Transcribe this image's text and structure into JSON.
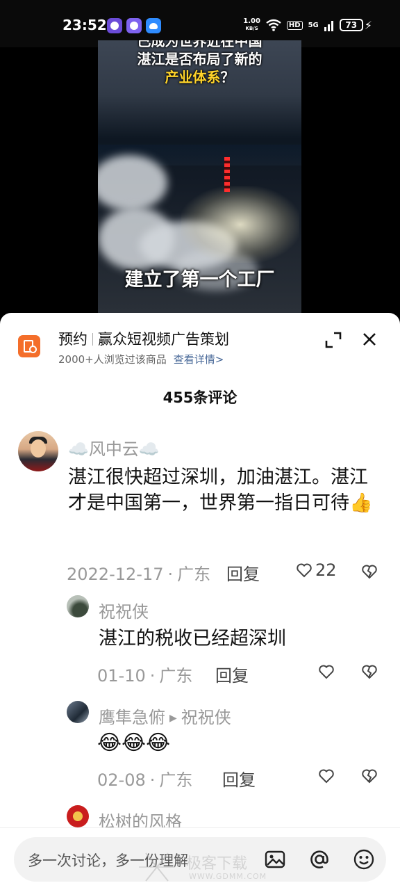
{
  "status_bar": {
    "time": "23:52",
    "net_speed": "1.00",
    "net_speed_unit": "KB/S",
    "hd_badge": "HD",
    "network": "5G",
    "battery": "73",
    "icons": [
      "app-notification-icon",
      "app-notification-icon",
      "cloud-app-icon",
      "wifi-icon",
      "signal-icon",
      "battery-icon",
      "charging-icon"
    ]
  },
  "video": {
    "caption_top": {
      "line1": "已成为世界近在中国",
      "line2": "湛江是否布局了新的",
      "line3_highlight": "产业体系",
      "line3_tail": "？"
    },
    "caption_bottom": "建立了第一个工厂"
  },
  "promo": {
    "tag": "预约",
    "title": "赢众短视频广告策划",
    "views": "2000+人浏览过该商品",
    "link": "查看详情>",
    "accent_color": "#f46e2a"
  },
  "comments_header": "455条评论",
  "comments": [
    {
      "username": "☁️风中云☁️",
      "text": "湛江很快超过深圳，加油湛江。湛江才是中国第一，世界第一指日可待👍",
      "date": "2022-12-17",
      "location": "广东",
      "reply_label": "回复",
      "likes": "22"
    },
    {
      "username": "祝祝侠",
      "text": "湛江的税收已经超深圳",
      "date": "01-10",
      "location": "广东",
      "reply_label": "回复"
    },
    {
      "username": "鹰隼急俯",
      "reply_to": "祝祝侠",
      "text": "😂😂😂",
      "date": "02-08",
      "location": "广东",
      "reply_label": "回复"
    },
    {
      "username": "松树的风格"
    }
  ],
  "input": {
    "placeholder": "多一次讨论，多一份理解"
  },
  "watermark": {
    "text": "极客下载",
    "url": "WWW.GDMM.COM"
  }
}
